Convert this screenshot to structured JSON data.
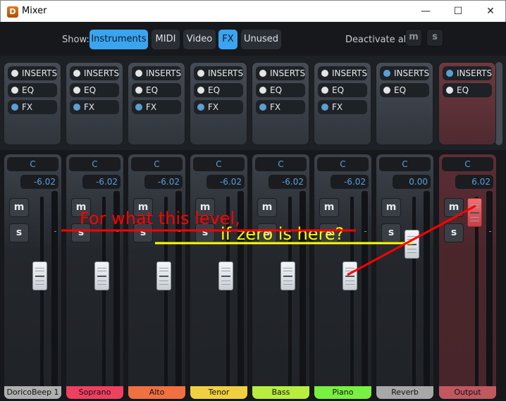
{
  "window": {
    "title": "Mixer",
    "icon": "dorico-app-icon",
    "controls": [
      "minimize",
      "maximize",
      "close"
    ]
  },
  "toolbar": {
    "show_label": "Show:",
    "filters": [
      {
        "label": "Instruments",
        "active": true
      },
      {
        "label": "MIDI",
        "active": false
      },
      {
        "label": "Video",
        "active": false
      },
      {
        "label": "FX",
        "active": true
      },
      {
        "label": "Unused",
        "active": false
      }
    ],
    "deactivate_label": "Deactivate all:",
    "mute_all": "m",
    "solo_all": "s"
  },
  "channels": [
    {
      "name": "DoricoBeep 1",
      "color": "#b0b0b0",
      "pan": "C",
      "level": "-6.02",
      "level_db": -6.02,
      "slots": [
        {
          "label": "INSERTS",
          "on": false
        },
        {
          "label": "EQ",
          "on": false
        },
        {
          "label": "FX",
          "on": true
        }
      ]
    },
    {
      "name": "Soprano",
      "color": "#f04060",
      "pan": "C",
      "level": "-6.02",
      "level_db": -6.02,
      "slots": [
        {
          "label": "INSERTS",
          "on": false
        },
        {
          "label": "EQ",
          "on": false
        },
        {
          "label": "FX",
          "on": true
        }
      ]
    },
    {
      "name": "Alto",
      "color": "#f07040",
      "pan": "C",
      "level": "-6.02",
      "level_db": -6.02,
      "slots": [
        {
          "label": "INSERTS",
          "on": false
        },
        {
          "label": "EQ",
          "on": false
        },
        {
          "label": "FX",
          "on": true
        }
      ]
    },
    {
      "name": "Tenor",
      "color": "#f0d040",
      "pan": "C",
      "level": "-6.02",
      "level_db": -6.02,
      "slots": [
        {
          "label": "INSERTS",
          "on": false
        },
        {
          "label": "EQ",
          "on": false
        },
        {
          "label": "FX",
          "on": true
        }
      ]
    },
    {
      "name": "Bass",
      "color": "#b8ec40",
      "pan": "C",
      "level": "-6.02",
      "level_db": -6.02,
      "slots": [
        {
          "label": "INSERTS",
          "on": false
        },
        {
          "label": "EQ",
          "on": false
        },
        {
          "label": "FX",
          "on": true
        }
      ]
    },
    {
      "name": "Piano",
      "color": "#78f040",
      "pan": "C",
      "level": "-6.02",
      "level_db": -6.02,
      "slots": [
        {
          "label": "INSERTS",
          "on": false
        },
        {
          "label": "EQ",
          "on": false
        },
        {
          "label": "FX",
          "on": true
        }
      ]
    },
    {
      "name": "Reverb",
      "color": "#a8a8a8",
      "pan": "C",
      "level": "0.00",
      "level_db": 0,
      "slots": [
        {
          "label": "INSERTS",
          "on": true
        },
        {
          "label": "EQ",
          "on": false
        }
      ]
    },
    {
      "name": "Output",
      "color": "#c05860",
      "pan": "C",
      "level": "6.02",
      "level_db": 6.02,
      "output": true,
      "slots": [
        {
          "label": "INSERTS",
          "on": true
        },
        {
          "label": "EQ",
          "on": false
        }
      ]
    }
  ],
  "strip_buttons": {
    "mute": "m",
    "solo": "s"
  },
  "annotations": {
    "note1": "For what this level,",
    "note2": "if zero is here?",
    "color1": "#ff0000",
    "color2": "#ffff00"
  }
}
